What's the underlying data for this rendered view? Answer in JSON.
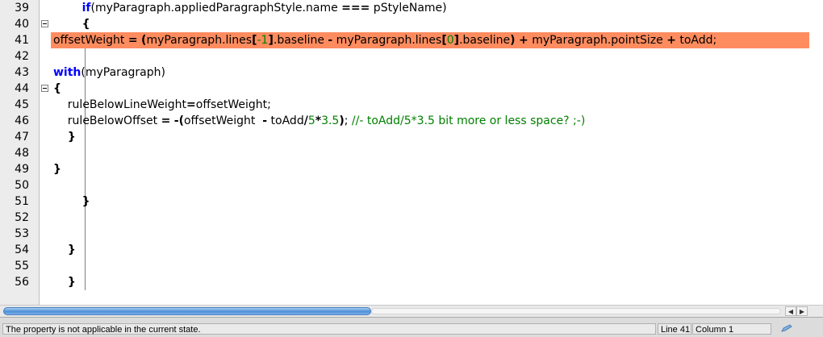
{
  "editor": {
    "lines": [
      {
        "num": "39",
        "tokens": [
          {
            "t": "        "
          },
          {
            "t": "if",
            "c": "kw"
          },
          {
            "t": "(myParagraph.appliedParagraphStyle.name "
          },
          {
            "t": "===",
            "c": "op"
          },
          {
            "t": " pStyleName)"
          }
        ]
      },
      {
        "num": "40",
        "tokens": [
          {
            "t": "        "
          },
          {
            "t": "{",
            "c": "op"
          }
        ]
      },
      {
        "num": "41",
        "highlight": true,
        "tokens": [
          {
            "t": "offsetWeight "
          },
          {
            "t": "=",
            "c": "op"
          },
          {
            "t": " "
          },
          {
            "t": "(",
            "c": "op"
          },
          {
            "t": "myParagraph.lines"
          },
          {
            "t": "[",
            "c": "op"
          },
          {
            "t": "-1",
            "c": "numlit"
          },
          {
            "t": "]",
            "c": "op"
          },
          {
            "t": ".baseline "
          },
          {
            "t": "-",
            "c": "op"
          },
          {
            "t": " myParagraph.lines"
          },
          {
            "t": "[",
            "c": "op"
          },
          {
            "t": "0",
            "c": "numlit"
          },
          {
            "t": "]",
            "c": "op"
          },
          {
            "t": ".baseline"
          },
          {
            "t": ")",
            "c": "op"
          },
          {
            "t": " "
          },
          {
            "t": "+",
            "c": "op"
          },
          {
            "t": " myParagraph.pointSize "
          },
          {
            "t": "+",
            "c": "op"
          },
          {
            "t": " toAdd;"
          }
        ]
      },
      {
        "num": "42",
        "tokens": []
      },
      {
        "num": "43",
        "tokens": [
          {
            "t": "with",
            "c": "kw"
          },
          {
            "t": "(myParagraph)"
          }
        ]
      },
      {
        "num": "44",
        "tokens": [
          {
            "t": "{",
            "c": "op"
          }
        ]
      },
      {
        "num": "45",
        "tokens": [
          {
            "t": "    ruleBelowLineWeight"
          },
          {
            "t": "=",
            "c": "op"
          },
          {
            "t": "offsetWeight;"
          }
        ]
      },
      {
        "num": "46",
        "tokens": [
          {
            "t": "    ruleBelowOffset "
          },
          {
            "t": "=",
            "c": "op"
          },
          {
            "t": " "
          },
          {
            "t": "-(",
            "c": "op"
          },
          {
            "t": "offsetWeight  "
          },
          {
            "t": "-",
            "c": "op"
          },
          {
            "t": " toAdd"
          },
          {
            "t": "/",
            "c": "op"
          },
          {
            "t": "5",
            "c": "numlit"
          },
          {
            "t": "*",
            "c": "op"
          },
          {
            "t": "3.5",
            "c": "numlit"
          },
          {
            "t": ")",
            "c": "op"
          },
          {
            "t": "; "
          },
          {
            "t": "//- toAdd/5*3.5 bit more or less space? ;-)",
            "c": "cmt"
          }
        ]
      },
      {
        "num": "47",
        "tokens": [
          {
            "t": "    "
          },
          {
            "t": "}",
            "c": "op"
          }
        ]
      },
      {
        "num": "48",
        "tokens": []
      },
      {
        "num": "49",
        "tokens": [
          {
            "t": "}",
            "c": "op"
          }
        ]
      },
      {
        "num": "50",
        "tokens": []
      },
      {
        "num": "51",
        "tokens": [
          {
            "t": "        "
          },
          {
            "t": "}",
            "c": "op"
          }
        ]
      },
      {
        "num": "52",
        "tokens": []
      },
      {
        "num": "53",
        "tokens": []
      },
      {
        "num": "54",
        "tokens": [
          {
            "t": "    "
          },
          {
            "t": "}",
            "c": "op"
          }
        ]
      },
      {
        "num": "55",
        "tokens": []
      },
      {
        "num": "56",
        "tokens": [
          {
            "t": "    "
          },
          {
            "t": "}",
            "c": "op"
          }
        ]
      }
    ],
    "highlight_color": "#ff8c5f",
    "keyword_color": "#0000ff",
    "comment_color": "#008000"
  },
  "scrollbar": {
    "up_arrow": "▲",
    "down_arrow": "▼",
    "left_arrow": "◀",
    "right_arrow": "▶"
  },
  "status": {
    "message": "The property is not applicable in the current state.",
    "line": "Line 41",
    "column": "Column 1",
    "edit_icon": "pencil-icon"
  }
}
